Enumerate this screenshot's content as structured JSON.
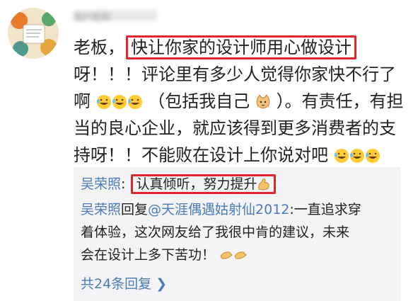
{
  "comment": {
    "username": "用户昵称",
    "lines": [
      {
        "before": "老板，",
        "boxed": "快让你家的设计师用心做设计"
      },
      {
        "text": "呀！！！评论里有多少人觉得你家快不行了"
      },
      {
        "a": "啊",
        "b": "（包括我自己",
        "c": "）。有责任，有担"
      },
      {
        "text": "当的良心企业，就应该得到更多消费者的支"
      },
      {
        "text": "持呀！！不能败在设计上你说对吧"
      }
    ]
  },
  "replies": [
    {
      "name": "吴荣照",
      "sep": ": ",
      "boxed": "认真倾听，努力提升"
    },
    {
      "name": "吴荣照",
      "verb": "回复",
      "mention": "@天涯偶遇姑射仙2012",
      "text1": ":一直追求穿",
      "line2": "着体验，这次网友给了我很中肯的建议，未来",
      "line3": "会在设计上多下苦功！"
    }
  ],
  "more_replies": "共24条回复 ❯",
  "icons": [
    "avatar-image",
    "laughing-crying-emoji",
    "cat-emoji",
    "flexed-arm-emoji",
    "clapping-hands-emoji",
    "chevron-right-icon"
  ]
}
